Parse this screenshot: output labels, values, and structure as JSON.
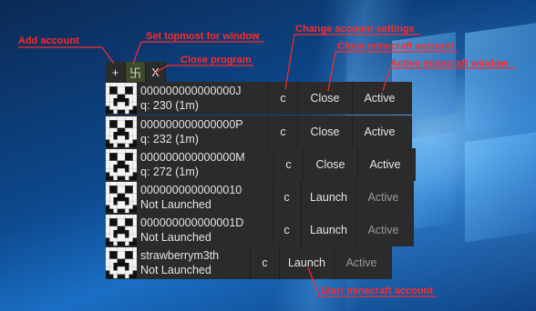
{
  "toolbar": {
    "add_label": "+",
    "pin_label": "卐",
    "close_label": "X"
  },
  "accounts": [
    {
      "name": "000000000000000J",
      "status": "q: 230 (1m)",
      "c": "c",
      "action": "Close",
      "active": "Active",
      "active_enabled": true
    },
    {
      "name": "000000000000000P",
      "status": "q: 232 (1m)",
      "c": "c",
      "action": "Close",
      "active": "Active",
      "active_enabled": true
    },
    {
      "name": "000000000000000M",
      "status": "q: 272 (1m)",
      "c": "c",
      "action": "Close",
      "active": "Active",
      "active_enabled": true
    },
    {
      "name": "0000000000000010",
      "status": "Not Launched",
      "c": "c",
      "action": "Launch",
      "active": "Active",
      "active_enabled": false
    },
    {
      "name": "000000000000001D",
      "status": "Not Launched",
      "c": "c",
      "action": "Launch",
      "active": "Active",
      "active_enabled": false
    },
    {
      "name": "strawberrym3th",
      "status": "Not Launched",
      "c": "c",
      "action": "Launch",
      "active": "Active",
      "active_enabled": false
    }
  ],
  "annotations": {
    "add_account": "Add account",
    "set_topmost": "Set topmost for window",
    "close_program": "Close program",
    "change_settings": "Change account settings",
    "close_minecraft": "Close minecraft account",
    "active_window": "Active minecraft window",
    "start_minecraft": "Start minecraft account"
  },
  "colors": {
    "annotation": "#ff2a2a",
    "panel": "#2b2b2b",
    "text": "#e4e4e4"
  }
}
